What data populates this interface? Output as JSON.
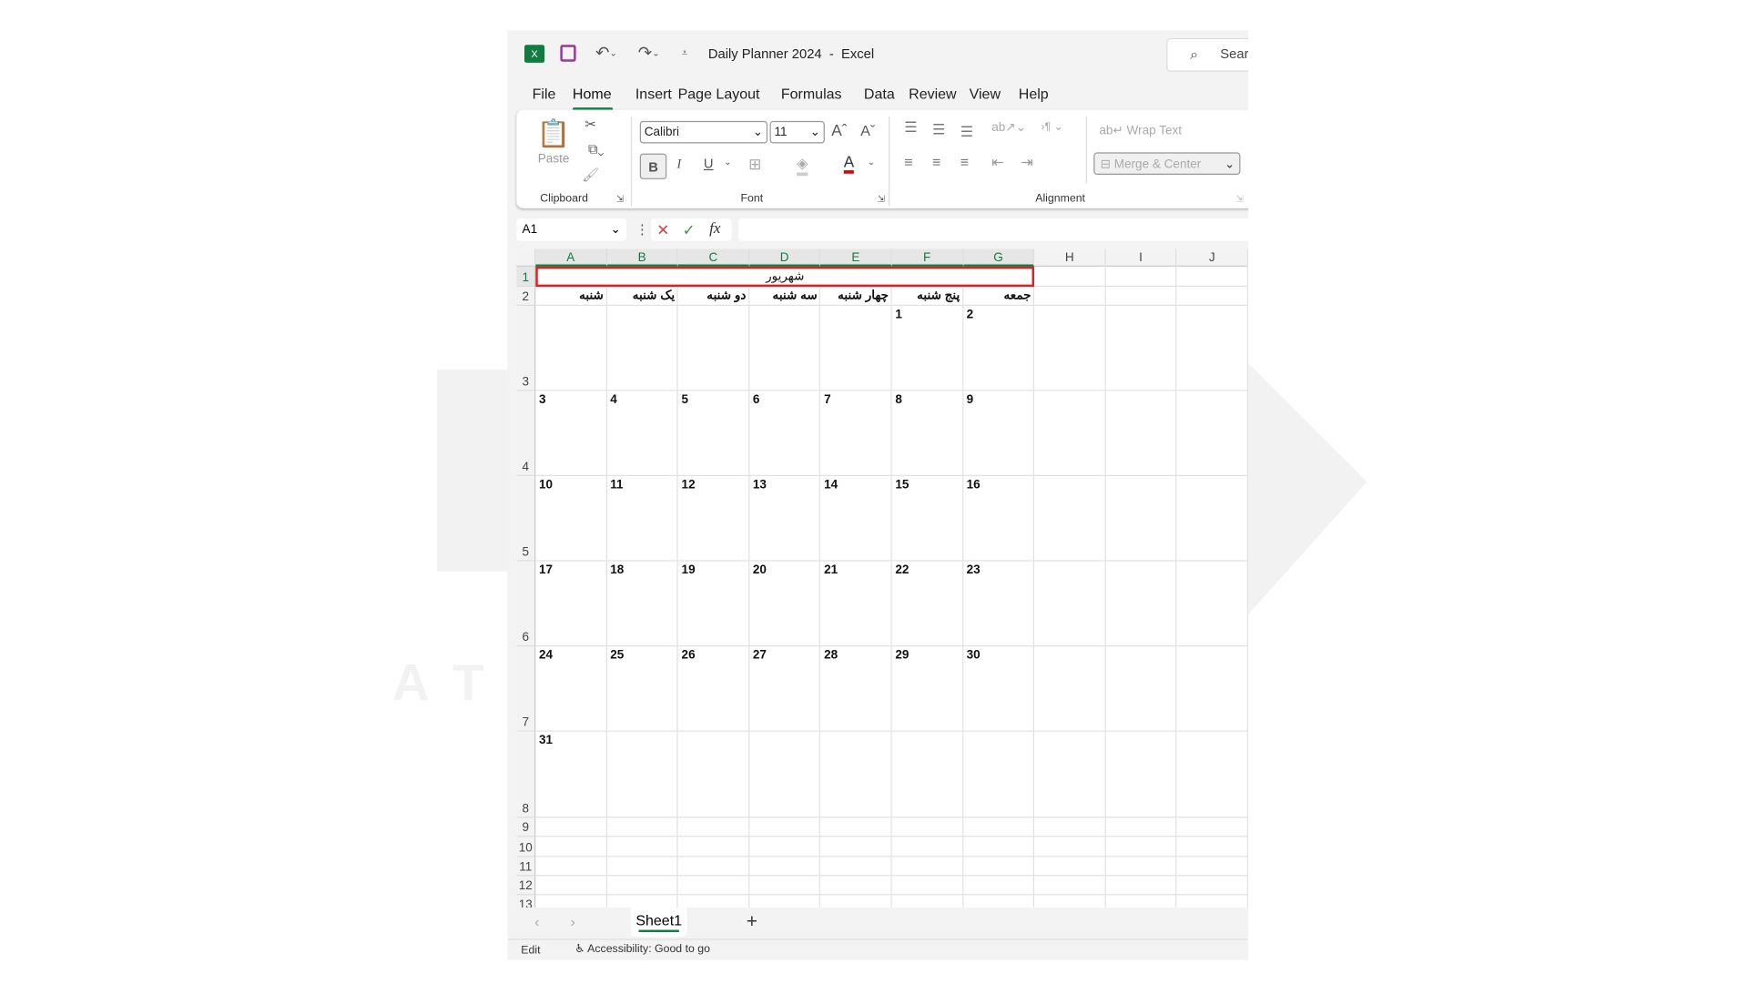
{
  "window": {
    "title": "Daily Planner 2024",
    "app": "Excel",
    "title_sep": "-",
    "search_placeholder": "Sear"
  },
  "menu_tabs": [
    {
      "label": "File"
    },
    {
      "label": "Home",
      "active": true
    },
    {
      "label": "Insert"
    },
    {
      "label": "Page Layout"
    },
    {
      "label": "Formulas"
    },
    {
      "label": "Data"
    },
    {
      "label": "Review"
    },
    {
      "label": "View"
    },
    {
      "label": "Help"
    }
  ],
  "ribbon": {
    "paste": "Paste",
    "clipboard": "Clipboard",
    "font_name": "Calibri",
    "font_size": "11",
    "font": "Font",
    "bold": "B",
    "italic": "I",
    "underline": "U",
    "wrap_text": "Wrap Text",
    "merge_center": "Merge & Center",
    "alignment": "Alignment",
    "font_color": "#e00000"
  },
  "formula_bar": {
    "name_box": "A1",
    "value": ""
  },
  "columns": [
    "A",
    "B",
    "C",
    "D",
    "E",
    "F",
    "G",
    "H",
    "I",
    "J"
  ],
  "rows": [
    "1",
    "2",
    "3",
    "4",
    "5",
    "6",
    "7",
    "8",
    "9",
    "10",
    "11",
    "12",
    "13"
  ],
  "sheet": {
    "title": "شهریور",
    "weekdays": [
      "شنبه",
      "یک شنبه",
      "دو شنبه",
      "سه شنبه",
      "چهار شنبه",
      "پنج شنبه",
      "جمعه"
    ],
    "weeks": [
      [
        "",
        "",
        "",
        "",
        "",
        "1",
        "2"
      ],
      [
        "3",
        "4",
        "5",
        "6",
        "7",
        "8",
        "9"
      ],
      [
        "10",
        "11",
        "12",
        "13",
        "14",
        "15",
        "16"
      ],
      [
        "17",
        "18",
        "19",
        "20",
        "21",
        "22",
        "23"
      ],
      [
        "24",
        "25",
        "26",
        "27",
        "28",
        "29",
        "30"
      ],
      [
        "31",
        "",
        "",
        "",
        "",
        "",
        ""
      ]
    ],
    "selection_color": "#e02020"
  },
  "sheet_tabs": [
    {
      "label": "Sheet1",
      "active": true
    }
  ],
  "status": {
    "mode": "Edit",
    "accessibility": "Accessibility: Good to go"
  },
  "watermark": {
    "text": "ATRO ACADEMY"
  },
  "colors": {
    "accent": "#107c41"
  }
}
